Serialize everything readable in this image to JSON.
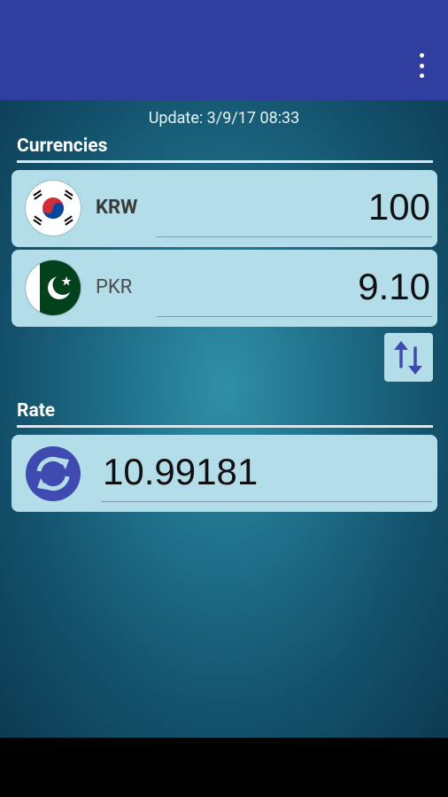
{
  "update": "Update: 3/9/17 08:33",
  "sections": {
    "currencies": "Currencies",
    "rate": "Rate"
  },
  "currencies": [
    {
      "code": "KRW",
      "amount": "100"
    },
    {
      "code": "PKR",
      "amount": "9.10"
    }
  ],
  "rate": {
    "value": "10.99181"
  },
  "icons": {
    "menu": "more-vert-icon",
    "swap": "swap-vertical-icon",
    "refresh": "refresh-icon"
  },
  "colors": {
    "appbar": "#303f9f",
    "card": "#b3dde9",
    "accent": "#3f4bb0"
  }
}
